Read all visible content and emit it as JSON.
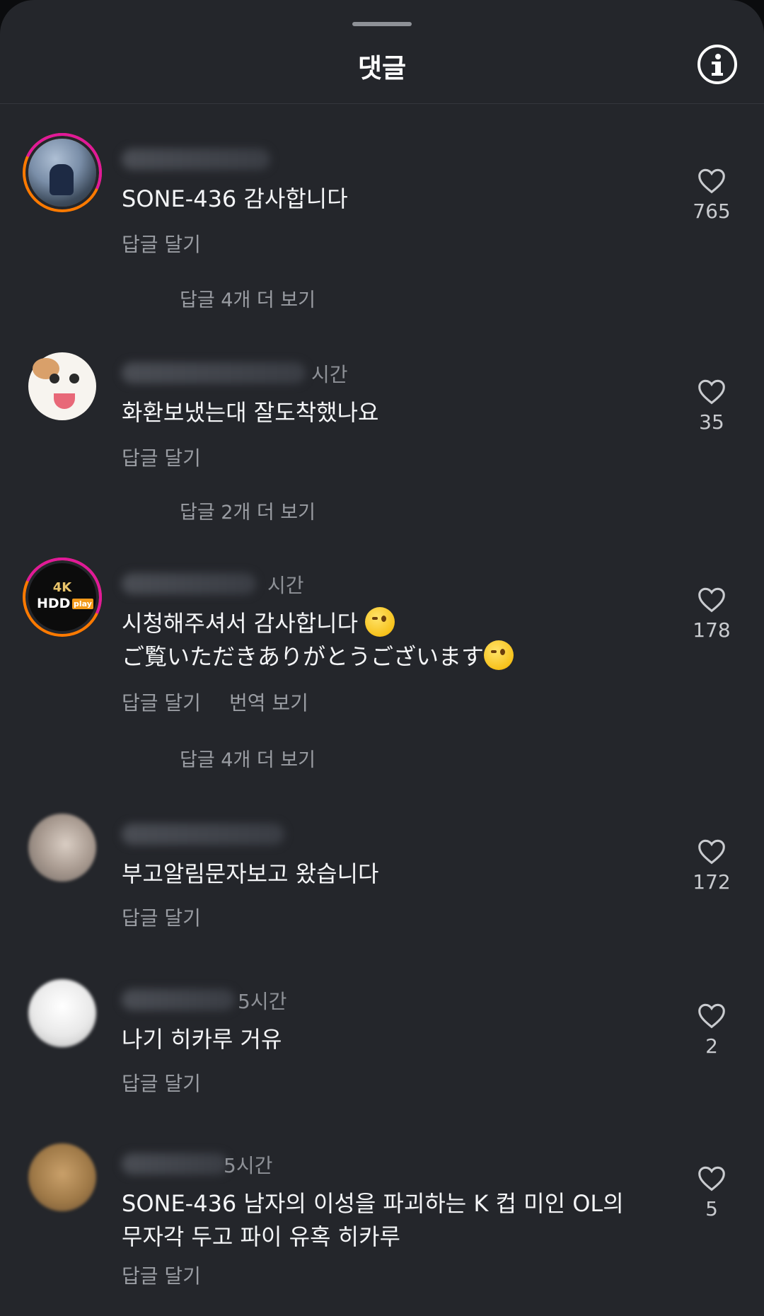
{
  "header": {
    "title": "댓글"
  },
  "comments": [
    {
      "meta": "",
      "text": "SONE-436 감사합니다",
      "actions": [
        "답글 달기"
      ],
      "more_replies": "답글 4개 더 보기",
      "likes": "765"
    },
    {
      "meta": "시간",
      "text": "화환보냈는대 잘도착했나요",
      "actions": [
        "답글 달기"
      ],
      "more_replies": "답글 2개 더 보기",
      "likes": "35"
    },
    {
      "meta": "시간",
      "avatar_text": {
        "l1": "4K",
        "l2": "HDD",
        "l3": "play"
      },
      "text_line1": "시청해주셔서 감사합니다",
      "text_line2": "ご覧いただきありがとうございます",
      "actions": [
        "답글 달기",
        "번역 보기"
      ],
      "more_replies": "답글 4개 더 보기",
      "likes": "178"
    },
    {
      "meta": "",
      "text": "부고알림문자보고 왔습니다",
      "actions": [
        "답글 달기"
      ],
      "likes": "172"
    },
    {
      "meta": "5시간",
      "text": "나기 히카루 거유",
      "actions": [
        "답글 달기"
      ],
      "likes": "2"
    },
    {
      "meta": "5시간",
      "text_line1": "SONE-436 남자의 이성을 파괴하는 K 컵 미인 OL의",
      "text_line2": "무자각 두고 파이 유혹 히카루",
      "actions": [
        "답글 달기"
      ],
      "likes": "5"
    }
  ],
  "icons": {
    "info": "info-icon",
    "like": "heart-outline-icon"
  },
  "colors": {
    "background": "#24262b",
    "text": "#f4f5f7",
    "secondary": "#9a9da3",
    "ring_orange": "#ff7a00",
    "ring_pink": "#e0199a"
  }
}
